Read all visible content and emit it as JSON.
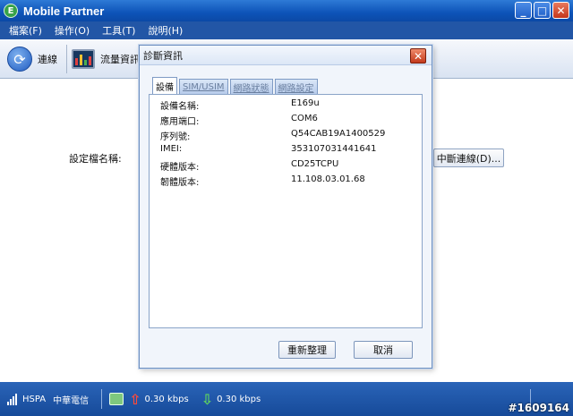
{
  "window": {
    "title": "Mobile Partner",
    "app_icon": "E"
  },
  "window_buttons": {
    "minimize": "_",
    "maximize": "□",
    "close": "✕"
  },
  "menu": [
    "檔案(F)",
    "操作(O)",
    "工具(T)",
    "說明(H)"
  ],
  "toolbar": {
    "connect_label": "連線",
    "traffic_label": "流量資訊"
  },
  "main": {
    "profile_label": "設定檔名稱:",
    "disconnect_button": "中斷連線(D)..."
  },
  "status_bar": {
    "network_type": "HSPA",
    "operator": "中華電信",
    "upload_speed": "0.30 kbps",
    "download_speed": "0.30 kbps",
    "watermark": "#1609164"
  },
  "dialog": {
    "title": "診斷資訊",
    "close": "✕",
    "tabs": [
      "設備",
      "SIM/USIM",
      "網路狀態",
      "網路設定"
    ],
    "active_tab": 0,
    "rows": [
      {
        "key": "設備名稱:",
        "value": "E169u"
      },
      {
        "key": "應用端口:",
        "value": "COM6"
      },
      {
        "key": "序列號:",
        "value": "Q54CAB19A1400529"
      },
      {
        "key": "IMEI:",
        "value": "353107031441641"
      },
      {
        "key": "硬體版本:",
        "value": "CD25TCPU"
      },
      {
        "key": "韌體版本:",
        "value": "11.108.03.01.68"
      }
    ],
    "refresh_button": "重新整理",
    "cancel_button": "取消"
  },
  "icons": [
    "app-icon",
    "connect-icon",
    "traffic-monitor-icon",
    "signal-icon",
    "network-icon",
    "upload-arrow-icon",
    "download-arrow-icon",
    "close-icon"
  ],
  "colors": {
    "title_bar": "#0d53b8",
    "menu_bar": "#2256a6",
    "status_bar": "#164a99",
    "dialog_close": "#c33a1c",
    "upload": "#ff4a3a",
    "download": "#5fd35f"
  }
}
